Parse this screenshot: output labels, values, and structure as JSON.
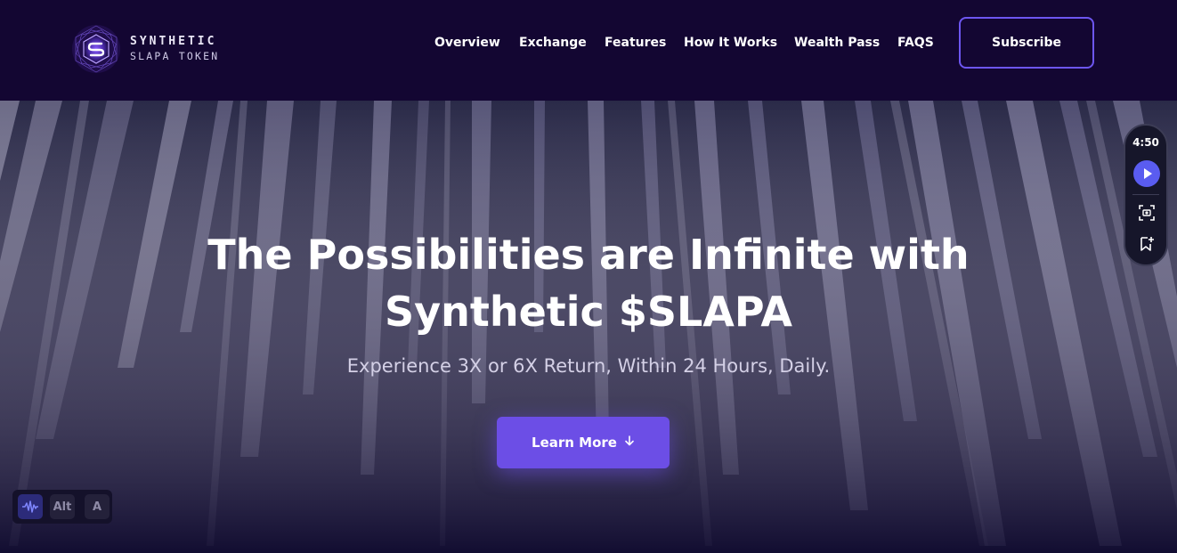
{
  "brand": {
    "name_line1": "SYNTHETIC",
    "name_line2": "SLAPA TOKEN",
    "logo_icon": "hexagon-s-logo-icon",
    "accent": "#6c4ee6"
  },
  "nav": {
    "items": [
      {
        "label": "Overview"
      },
      {
        "label": "Exchange"
      },
      {
        "label": "Features"
      },
      {
        "label": "How It Works"
      },
      {
        "label": "Wealth Pass"
      },
      {
        "label": "FAQS"
      }
    ],
    "subscribe_label": "Subscribe"
  },
  "hero": {
    "title_line1": "The Possibilities are Infinite with",
    "title_line2": "Synthetic $SLAPA",
    "subtitle": "Experience 3X or 6X Return, Within 24 Hours, Daily.",
    "cta_label": "Learn More",
    "cta_icon": "arrow-down-icon"
  },
  "side_widget": {
    "time": "4:50",
    "icons": [
      "play-icon",
      "screenshot-icon",
      "bookmark-add-icon"
    ]
  },
  "a11y_toolbar": {
    "wave_icon": "audio-wave-icon",
    "alt_label": "Alt",
    "a_label": "A"
  }
}
